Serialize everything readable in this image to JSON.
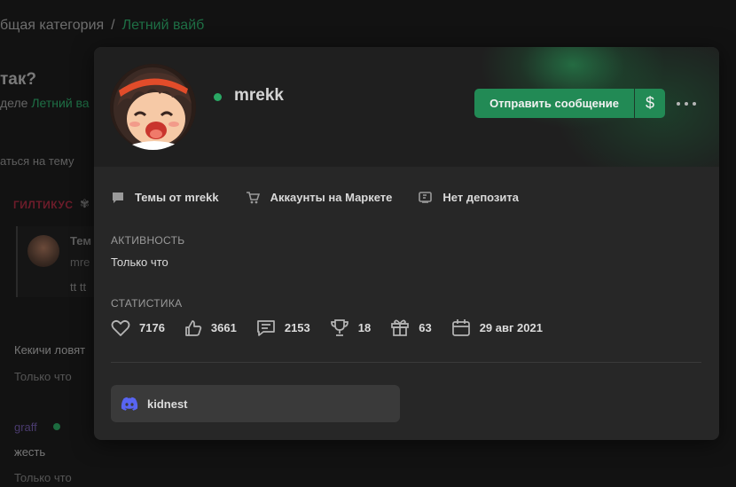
{
  "background": {
    "breadcrumb": {
      "first": "бщая категория",
      "separator": "/",
      "current": "Летний вайб"
    },
    "thread_title": "так?",
    "section_prefix": "деле",
    "section_link": "Летний ва",
    "reply_hint": "аться на тему",
    "nick_red": "ГИЛТИКУС",
    "quote": {
      "title": "Тем",
      "author": "mre",
      "text": "tt tt"
    },
    "post1": {
      "text": "Кекичи ловят",
      "time": "Только что"
    },
    "post2": {
      "nick": "graff",
      "text": "жесть",
      "time": "Только что"
    }
  },
  "profile": {
    "username": "mrekk",
    "online": true,
    "send_message_label": "Отправить сообщение",
    "money_label": "$",
    "links": {
      "threads": "Темы от mrekk",
      "market": "Аккаунты на Маркете",
      "deposit": "Нет депозита"
    },
    "activity_label": "АКТИВНОСТЬ",
    "activity_value": "Только что",
    "stats_label": "СТАТИСТИКА",
    "stats": {
      "likes": "7176",
      "thumbs": "3661",
      "messages": "2153",
      "trophies": "18",
      "gifts": "63",
      "registered": "29 авг 2021"
    },
    "contact": {
      "service": "discord",
      "name": "kidnest"
    }
  },
  "colors": {
    "accent_green": "#228a55",
    "online": "#2aa864",
    "discord": "#5865f2",
    "card_bg": "#272727"
  }
}
